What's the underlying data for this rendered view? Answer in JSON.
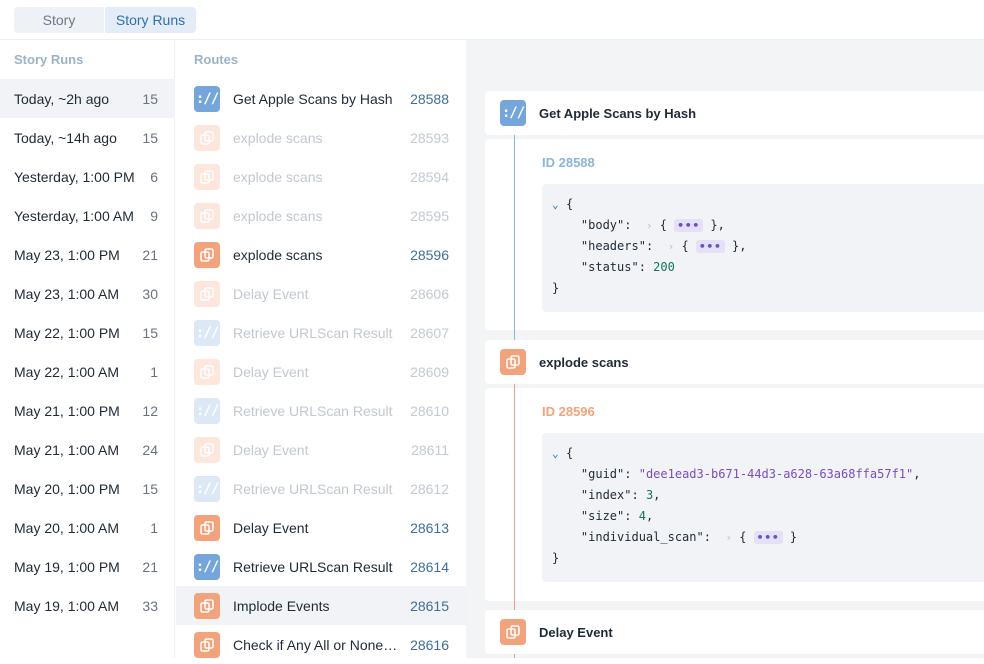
{
  "tabs": [
    {
      "label": "Story"
    },
    {
      "label": "Story Runs"
    }
  ],
  "story_runs": {
    "title": "Story Runs",
    "items": [
      {
        "label": "Today, ~2h ago",
        "count": "15"
      },
      {
        "label": "Today, ~14h ago",
        "count": "15"
      },
      {
        "label": "Yesterday, 1:00 PM",
        "count": "6"
      },
      {
        "label": "Yesterday, 1:00 AM",
        "count": "9"
      },
      {
        "label": "May 23, 1:00 PM",
        "count": "21"
      },
      {
        "label": "May 23, 1:00 AM",
        "count": "30"
      },
      {
        "label": "May 22, 1:00 PM",
        "count": "15"
      },
      {
        "label": "May 22, 1:00 AM",
        "count": "1"
      },
      {
        "label": "May 21, 1:00 PM",
        "count": "12"
      },
      {
        "label": "May 21, 1:00 AM",
        "count": "24"
      },
      {
        "label": "May 20, 1:00 PM",
        "count": "15"
      },
      {
        "label": "May 20, 1:00 AM",
        "count": "1"
      },
      {
        "label": "May 19, 1:00 PM",
        "count": "21"
      },
      {
        "label": "May 19, 1:00 AM",
        "count": "33"
      }
    ]
  },
  "routes": {
    "title": "Routes",
    "items": [
      {
        "name": "Get Apple Scans by Hash",
        "id": "28588",
        "icon": "http-icon"
      },
      {
        "name": "explode scans",
        "id": "28593",
        "icon": "explode-icon"
      },
      {
        "name": "explode scans",
        "id": "28594",
        "icon": "explode-icon"
      },
      {
        "name": "explode scans",
        "id": "28595",
        "icon": "explode-icon"
      },
      {
        "name": "explode scans",
        "id": "28596",
        "icon": "explode-icon"
      },
      {
        "name": "Delay Event",
        "id": "28606",
        "icon": "explode-icon"
      },
      {
        "name": "Retrieve URLScan Result",
        "id": "28607",
        "icon": "http-icon"
      },
      {
        "name": "Delay Event",
        "id": "28609",
        "icon": "explode-icon"
      },
      {
        "name": "Retrieve URLScan Result",
        "id": "28610",
        "icon": "http-icon"
      },
      {
        "name": "Delay Event",
        "id": "28611",
        "icon": "explode-icon"
      },
      {
        "name": "Retrieve URLScan Result",
        "id": "28612",
        "icon": "http-icon"
      },
      {
        "name": "Delay Event",
        "id": "28613",
        "icon": "explode-icon"
      },
      {
        "name": "Retrieve URLScan Result",
        "id": "28614",
        "icon": "http-icon"
      },
      {
        "name": "Implode Events",
        "id": "28615",
        "icon": "explode-icon"
      },
      {
        "name": "Check if Any All or None M...",
        "id": "28616",
        "icon": "explode-icon"
      }
    ]
  },
  "detail": {
    "card1": {
      "title": "Get Apple Scans by Hash",
      "id_label": "ID 28588",
      "json": {
        "open": "{",
        "k_body": "\"body\"",
        "k_headers": "\"headers\"",
        "k_status": "\"status\"",
        "v_status": "200",
        "ellipsis": "•••",
        "close": "}"
      }
    },
    "card2": {
      "title": "explode scans",
      "id_label": "ID 28596",
      "json": {
        "open": "{",
        "k_guid": "\"guid\"",
        "v_guid": "\"dee1ead3-b671-44d3-a628-63a68ffa57f1\"",
        "k_index": "\"index\"",
        "v_index": "3",
        "k_size": "\"size\"",
        "v_size": "4",
        "k_individual_scan": "\"individual_scan\"",
        "ellipsis": "•••",
        "close": "}"
      }
    },
    "card3": {
      "title": "Delay Event"
    }
  },
  "colors": {
    "http_icon": "#74a6dc",
    "explode_icon": "#f3a37b",
    "id_blue": "#8ab4dc",
    "id_orange": "#f3a37b"
  }
}
